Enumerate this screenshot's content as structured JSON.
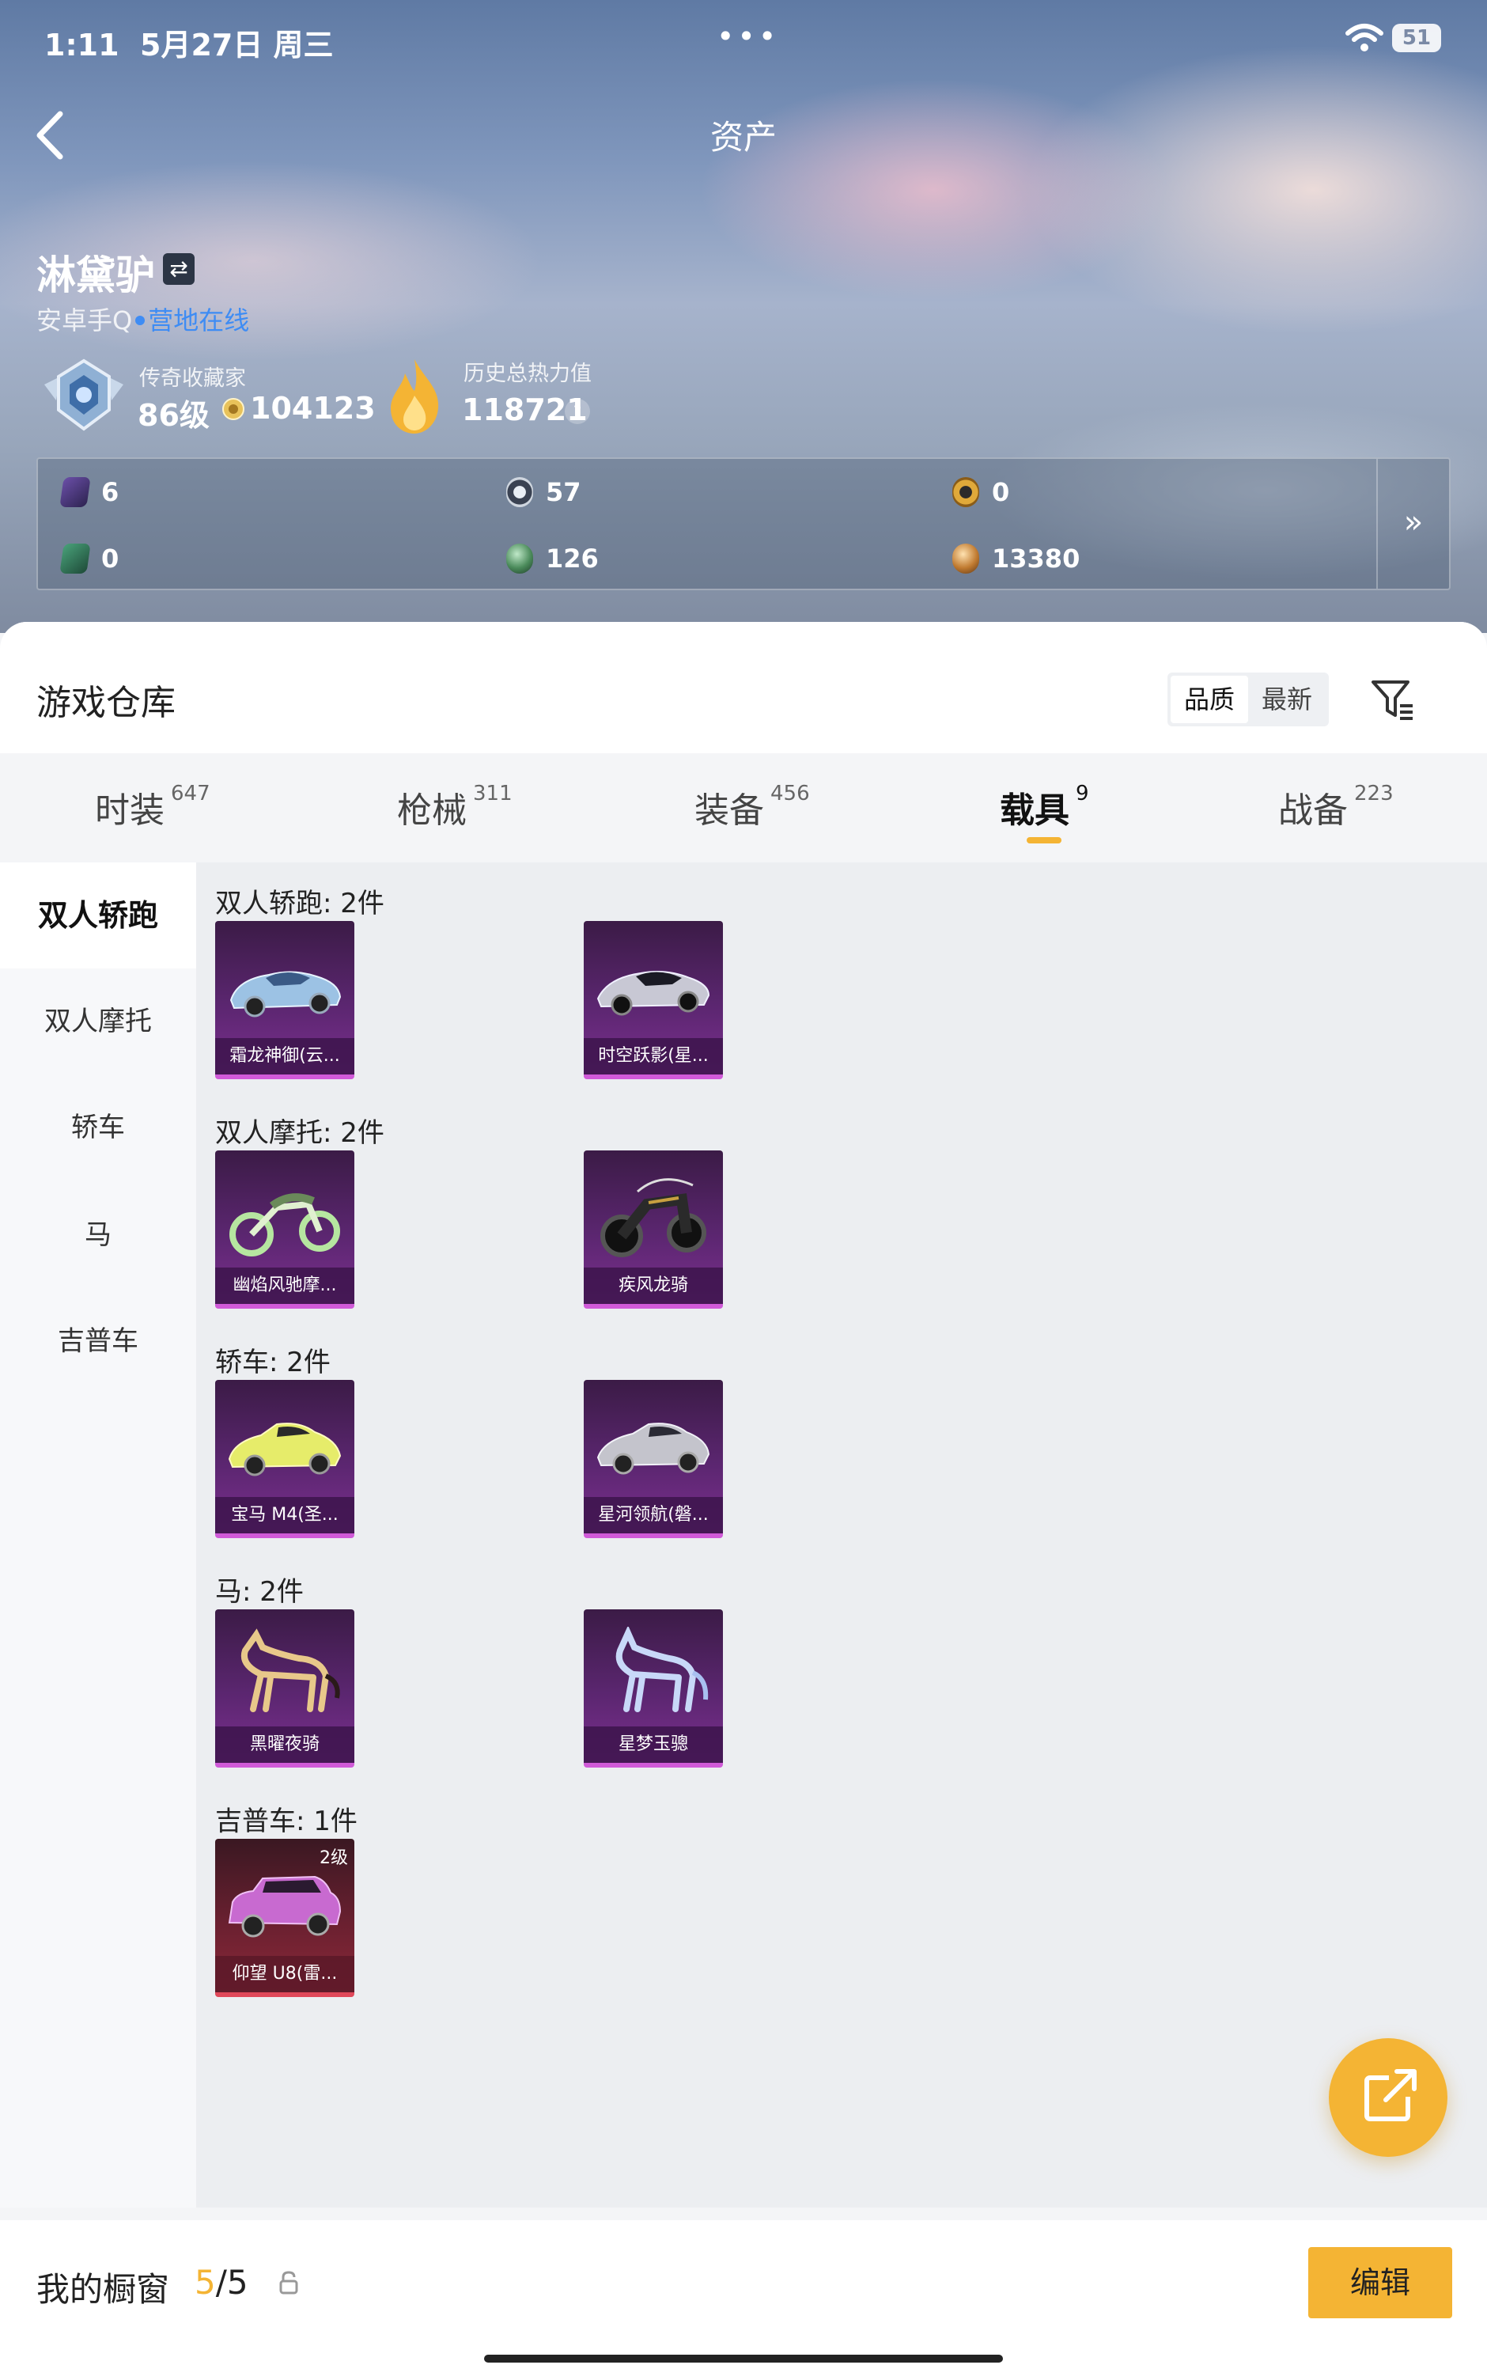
{
  "status": {
    "time": "1:11",
    "date": "5月27日 周三",
    "battery": "51"
  },
  "header": {
    "title": "资产"
  },
  "profile": {
    "name": "淋黛驴",
    "platform": "安卓手Q",
    "online_status": "营地在线",
    "collector_title": "传奇收藏家",
    "collector_level": "86级",
    "collector_coins": "104123",
    "heat_title": "历史总热力值",
    "heat_value": "118721",
    "help": "?"
  },
  "currencies": [
    {
      "icon": "purple-card-icon",
      "value": "6"
    },
    {
      "icon": "silver-token-icon",
      "value": "57"
    },
    {
      "icon": "gold-token-icon",
      "value": "0"
    },
    {
      "icon": "green-card-icon",
      "value": "0"
    },
    {
      "icon": "green-orb-icon",
      "value": "126"
    },
    {
      "icon": "bronze-orb-icon",
      "value": "13380"
    }
  ],
  "currency_more": "»",
  "warehouse": {
    "title": "游戏仓库",
    "sort_options": [
      "品质",
      "最新"
    ],
    "sort_selected": "品质"
  },
  "tabs": [
    {
      "label": "时装",
      "count": "647"
    },
    {
      "label": "枪械",
      "count": "311"
    },
    {
      "label": "装备",
      "count": "456"
    },
    {
      "label": "载具",
      "count": "9"
    },
    {
      "label": "战备",
      "count": "223"
    }
  ],
  "active_tab": "载具",
  "sidebar": [
    "双人轿跑",
    "双人摩托",
    "轿车",
    "马",
    "吉普车"
  ],
  "groups": [
    {
      "title": "双人轿跑: 2件",
      "items": [
        {
          "name": "霜龙神御(云...",
          "art": "coupe-car-icon"
        },
        {
          "name": "时空跃影(星...",
          "art": "coupe-car-icon"
        }
      ]
    },
    {
      "title": "双人摩托: 2件",
      "items": [
        {
          "name": "幽焰风驰摩...",
          "art": "motorcycle-icon"
        },
        {
          "name": "疾风龙骑",
          "art": "motorcycle-icon"
        }
      ]
    },
    {
      "title": "轿车: 2件",
      "items": [
        {
          "name": "宝马 M4(圣...",
          "art": "sedan-car-icon"
        },
        {
          "name": "星河领航(磐...",
          "art": "sedan-car-icon"
        }
      ]
    },
    {
      "title": "马: 2件",
      "items": [
        {
          "name": "黑曜夜骑",
          "art": "horse-icon"
        },
        {
          "name": "星梦玉骢",
          "art": "horse-icon"
        }
      ]
    },
    {
      "title": "吉普车: 1件",
      "items": [
        {
          "name": "仰望 U8(雷...",
          "art": "suv-icon",
          "level": "2级"
        }
      ]
    }
  ],
  "showcase": {
    "title": "我的橱窗",
    "current": "5",
    "total": "/5"
  },
  "edit_label": "编辑",
  "colors": {
    "accent": "#f4b434",
    "online": "#3e8cf4",
    "card_purple": "#7b2f8e",
    "card_red": "#8a2838"
  }
}
